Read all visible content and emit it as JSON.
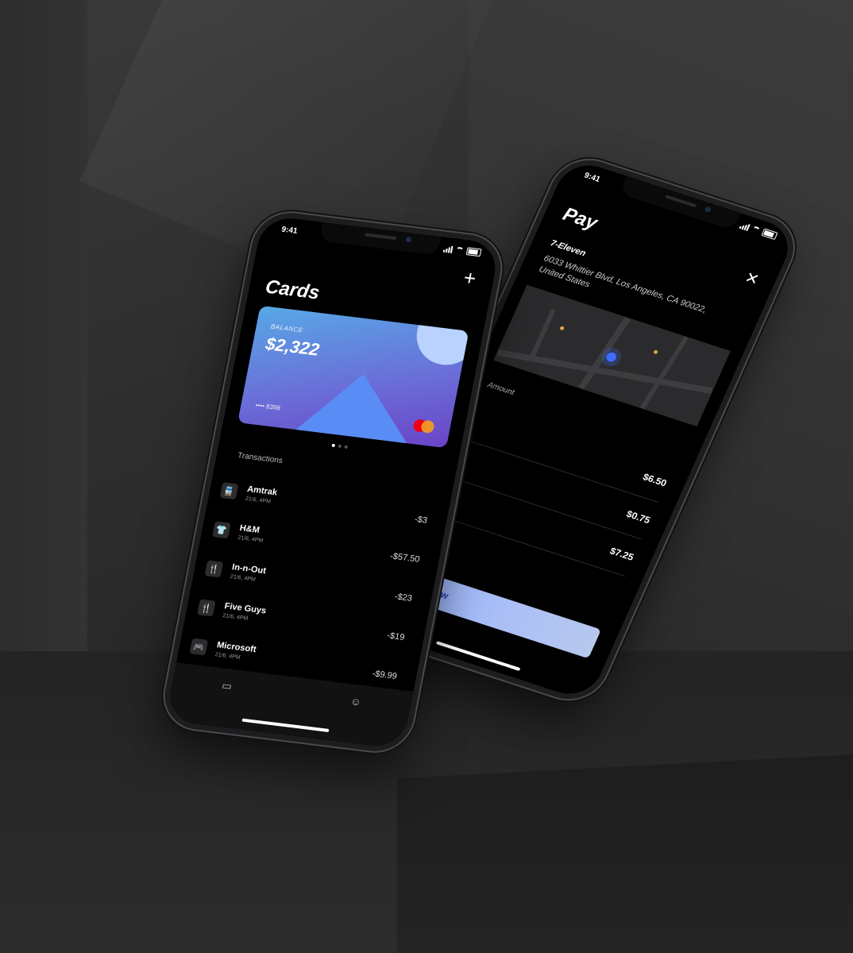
{
  "status": {
    "time": "9:41"
  },
  "cards_screen": {
    "title": "Cards",
    "add_icon": "plus-icon",
    "card": {
      "balance_label": "BALANCE",
      "balance": "$2,322",
      "number": "•••• 8398",
      "gradient": [
        "#58a8e6",
        "#6a44c6"
      ]
    },
    "section_label": "Transactions",
    "transactions": [
      {
        "icon": "train-icon",
        "name": "Amtrak",
        "date": "21/6, 4PM",
        "amount": "-$3"
      },
      {
        "icon": "shirt-icon",
        "name": "H&M",
        "date": "21/6, 4PM",
        "amount": "-$57.50"
      },
      {
        "icon": "fork-knife-icon",
        "name": "In-n-Out",
        "date": "21/6, 4PM",
        "amount": "-$23"
      },
      {
        "icon": "fork-knife-icon",
        "name": "Five Guys",
        "date": "21/6, 4PM",
        "amount": "-$19"
      },
      {
        "icon": "gamepad-icon",
        "name": "Microsoft",
        "date": "21/6, 4PM",
        "amount": "-$9.99"
      }
    ],
    "tabs": [
      {
        "icon": "wallet-icon"
      },
      {
        "icon": "smiley-icon"
      }
    ]
  },
  "pay_screen": {
    "title": "Pay",
    "close_icon": "close-icon",
    "merchant": "7-Eleven",
    "address": "6033 Whittier Blvd, Los Angeles, CA 90022, United States",
    "amount_label": "Amount",
    "amounts": [
      "$6.50",
      "$0.75",
      "$7.25"
    ],
    "pay_button": "Pay now"
  },
  "colors": {
    "accent": "#9bb4ff",
    "pin": "#3d6cff",
    "background": "#2b2b2b"
  }
}
